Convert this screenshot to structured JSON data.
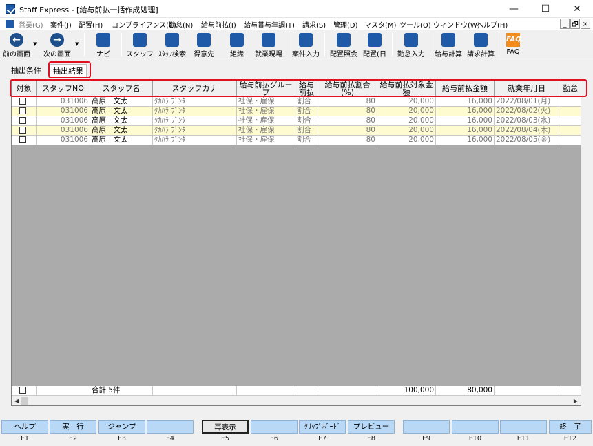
{
  "window": {
    "title": "Staff Express - [給与前払一括作成処理]",
    "controls": {
      "minimize": "—",
      "maximize": "☐",
      "close": "✕"
    }
  },
  "menubar": {
    "items": [
      "営業(G)",
      "案件(J)",
      "配置(H)",
      "コンプライアンス(C)",
      "勤怠(N)",
      "給与前払(I)",
      "給与賞与年調(T)",
      "請求(S)",
      "管理(D)",
      "マスタ(M)",
      "ツール(O)",
      "ウィンドウ(W)",
      "ヘルプ(H)"
    ],
    "mdi": {
      "minimize": "_",
      "restore": "🗗",
      "close": "×"
    }
  },
  "toolbar": {
    "back_label": "前の画面",
    "next_label": "次の画面",
    "nav_label": "ナビ",
    "staff_label": "スタッフ",
    "staff_search_label": "ｽﾀｯﾌ検索",
    "client_label": "得意先",
    "org_label": "組織",
    "site_label": "就業現場",
    "case_input_label": "案件入力",
    "assign_ref_label": "配置照会",
    "assign_day_label": "配置(日",
    "attendance_label": "勤怠入力",
    "pay_calc_label": "給与計算",
    "bill_calc_label": "請求計算",
    "faq_label": "FAQ",
    "faq_icon_text": "FAQ"
  },
  "tabs": {
    "criteria": "抽出条件",
    "results": "抽出結果"
  },
  "grid": {
    "columns": [
      "対象",
      "スタッフNO",
      "スタッフ名",
      "スタッフカナ",
      "給与前払グループ",
      "給与前払",
      "給与前払割合(%)",
      "給与前払対象金額",
      "給与前払金額",
      "就業年月日",
      "勤怠"
    ],
    "rows": [
      {
        "staff_no": "031006",
        "name": "高原　文太",
        "kana": "ﾀｶﾊﾗ ﾌﾞﾝﾀ",
        "group": "社保・雇保",
        "type": "割合",
        "rate": "80",
        "target": "20,000",
        "amount": "16,000",
        "date": "2022/08/01(月)"
      },
      {
        "staff_no": "031006",
        "name": "高原　文太",
        "kana": "ﾀｶﾊﾗ ﾌﾞﾝﾀ",
        "group": "社保・雇保",
        "type": "割合",
        "rate": "80",
        "target": "20,000",
        "amount": "16,000",
        "date": "2022/08/02(火)"
      },
      {
        "staff_no": "031006",
        "name": "高原　文太",
        "kana": "ﾀｶﾊﾗ ﾌﾞﾝﾀ",
        "group": "社保・雇保",
        "type": "割合",
        "rate": "80",
        "target": "20,000",
        "amount": "16,000",
        "date": "2022/08/03(水)"
      },
      {
        "staff_no": "031006",
        "name": "高原　文太",
        "kana": "ﾀｶﾊﾗ ﾌﾞﾝﾀ",
        "group": "社保・雇保",
        "type": "割合",
        "rate": "80",
        "target": "20,000",
        "amount": "16,000",
        "date": "2022/08/04(木)"
      },
      {
        "staff_no": "031006",
        "name": "高原　文太",
        "kana": "ﾀｶﾊﾗ ﾌﾞﾝﾀ",
        "group": "社保・雇保",
        "type": "割合",
        "rate": "80",
        "target": "20,000",
        "amount": "16,000",
        "date": "2022/08/05(金)"
      }
    ],
    "totals": {
      "label": "合計 5件",
      "target": "100,000",
      "amount": "80,000"
    }
  },
  "function_keys": [
    {
      "label": "ヘルプ",
      "key": "F1"
    },
    {
      "label": "実　行",
      "key": "F2"
    },
    {
      "label": "ジャンプ",
      "key": "F3"
    },
    {
      "label": "",
      "key": "F4"
    },
    {
      "label": "再表示",
      "key": "F5"
    },
    {
      "label": "",
      "key": "F6"
    },
    {
      "label": "ｸﾘｯﾌﾟﾎﾞｰﾄﾞ",
      "key": "F7"
    },
    {
      "label": "プレビュー",
      "key": "F8"
    },
    {
      "label": "",
      "key": "F9"
    },
    {
      "label": "",
      "key": "F10"
    },
    {
      "label": "",
      "key": "F11"
    },
    {
      "label": "終　了",
      "key": "F12"
    }
  ],
  "colors": {
    "row_highlight": "#fffbd0",
    "function_key": "#b8d8f5",
    "annotation_box": "#e01020",
    "grid_empty": "#ababab"
  }
}
